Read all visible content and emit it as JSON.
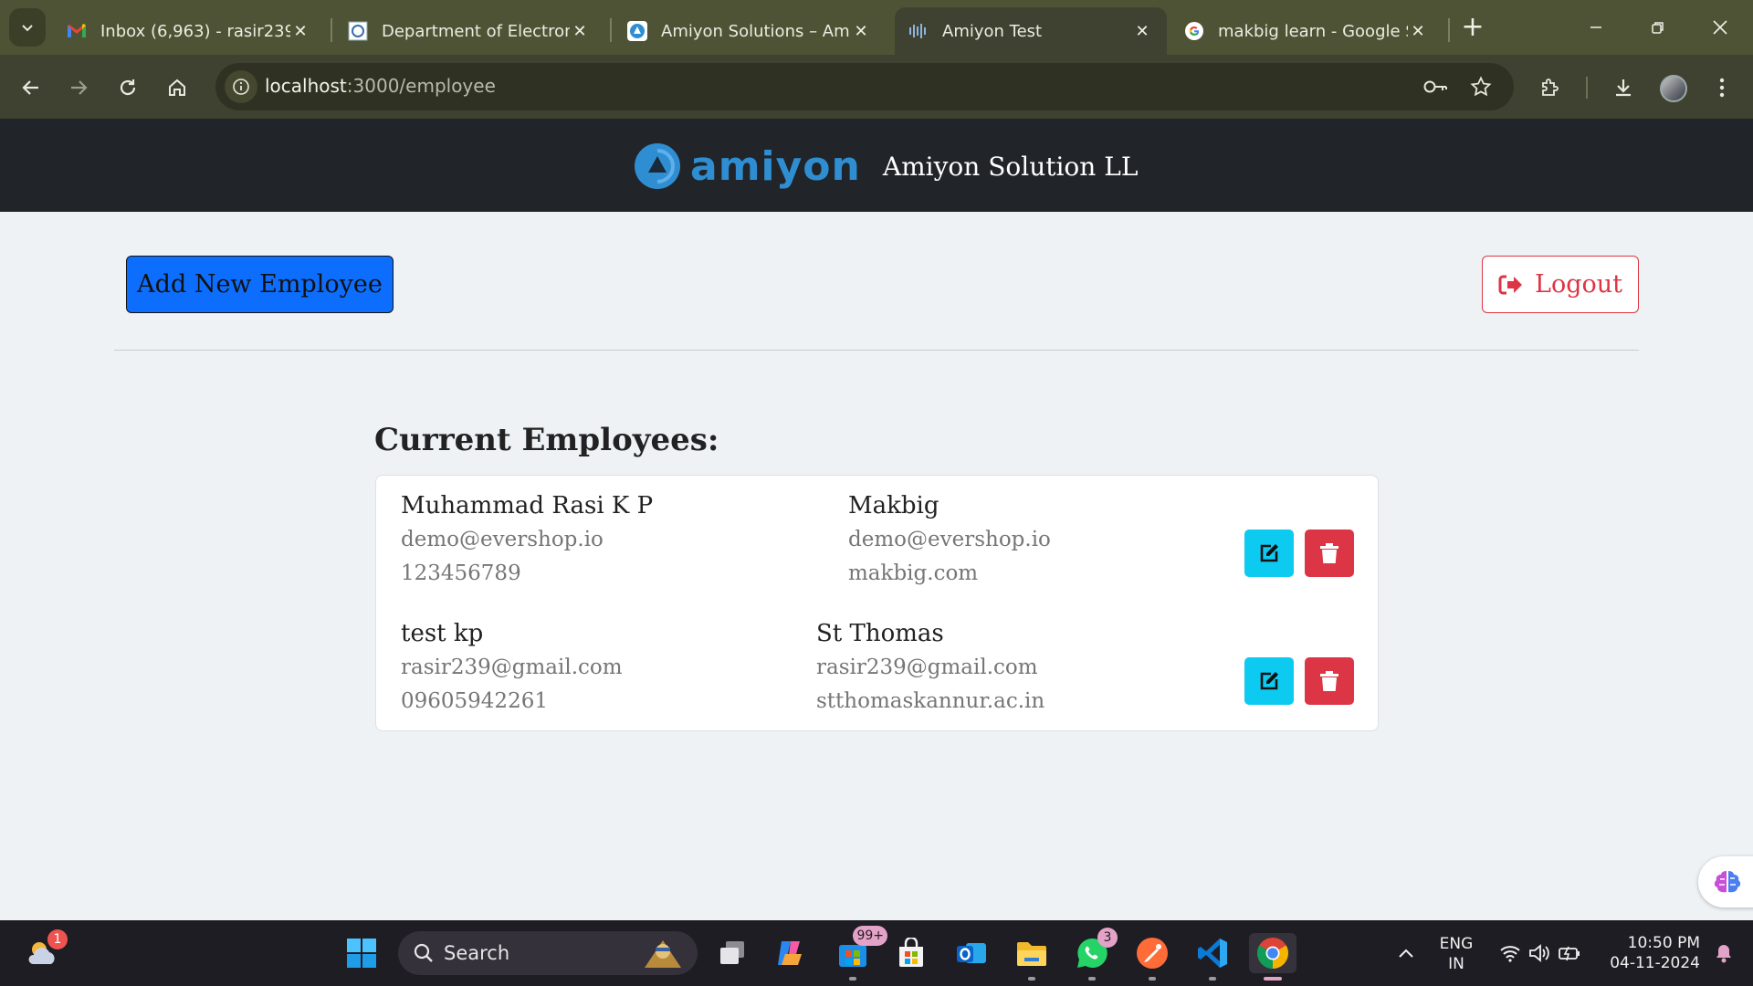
{
  "browser": {
    "tabs": [
      {
        "title": "Inbox (6,963) - rasir239@",
        "icon": "gmail-icon"
      },
      {
        "title": "Department of Electronic",
        "icon": "department-site-icon"
      },
      {
        "title": "Amiyon Solutions – Amiy",
        "icon": "amiyon-icon"
      },
      {
        "title": "Amiyon Test",
        "icon": "app-icon"
      },
      {
        "title": "makbig learn - Google Se",
        "icon": "google-icon"
      }
    ],
    "active_tab": 3,
    "url_host": "localhost",
    "url_path": ":3000/employee"
  },
  "header": {
    "brand_word": "amiyon",
    "company_name": "Amiyon Solution LL"
  },
  "actions": {
    "add_label": "Add New Employee",
    "logout_label": "Logout"
  },
  "employees_title": "Current Employees:",
  "employees": [
    {
      "name": "Muhammad Rasi K P",
      "email": "demo@evershop.io",
      "phone": "123456789",
      "company": "Makbig",
      "company_email": "demo@evershop.io",
      "website": "makbig.com"
    },
    {
      "name": "test kp",
      "email": "rasir239@gmail.com",
      "phone": "09605942261",
      "company": "St Thomas",
      "company_email": "rasir239@gmail.com",
      "website": "stthomaskannur.ac.in"
    }
  ],
  "taskbar": {
    "search_label": "Search",
    "widgets_badge": "1",
    "store_badge": "99+",
    "whatsapp_badge": "3",
    "lang_top": "ENG",
    "lang_bottom": "IN",
    "time": "10:50 PM",
    "date": "04-11-2024"
  },
  "colors": {
    "primary": "#0d6efd",
    "danger": "#dc3545",
    "info": "#0dcaf0",
    "header_bg": "#212529",
    "brand": "#2f8ed2"
  }
}
